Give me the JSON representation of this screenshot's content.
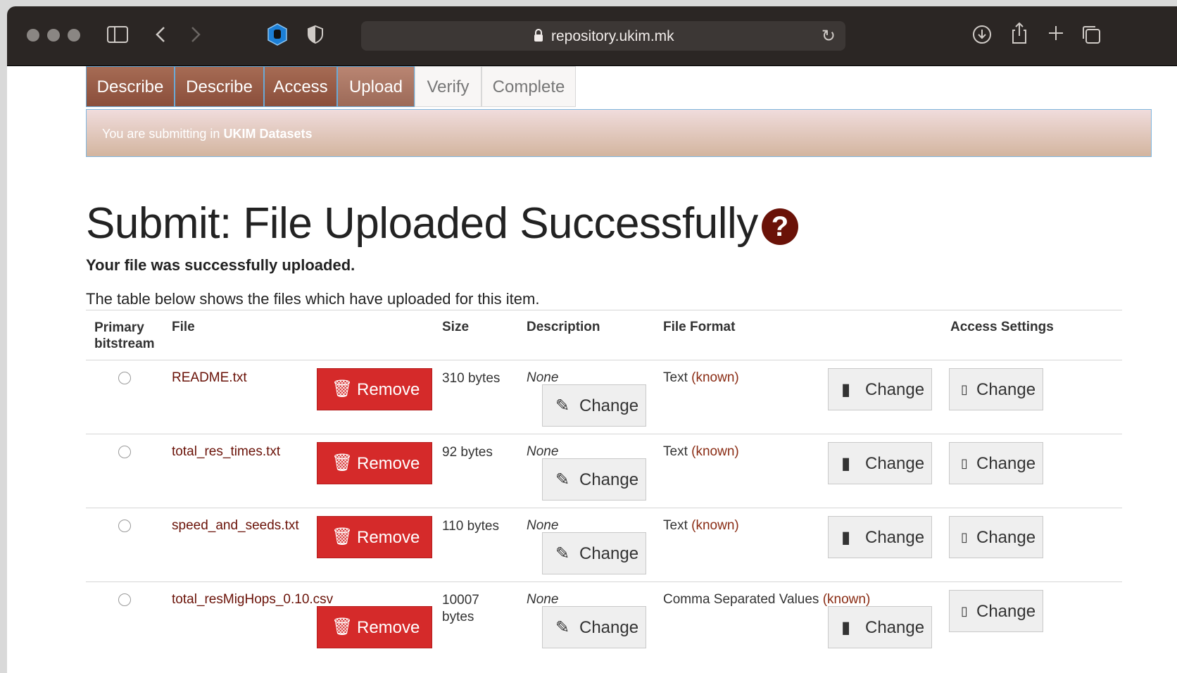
{
  "browser": {
    "url": "repository.ukim.mk",
    "icons": [
      "sidebar-icon",
      "back-icon",
      "forward-icon",
      "privacy-hand-icon",
      "shield-icon",
      "lock-icon",
      "reload-icon",
      "download-icon",
      "share-icon",
      "new-tab-icon",
      "tab-overview-icon"
    ]
  },
  "tabs": [
    "Describe",
    "Describe",
    "Access",
    "Upload",
    "Verify",
    "Complete"
  ],
  "banner": {
    "prefix": "You are submitting in ",
    "collection": "UKIM Datasets"
  },
  "page": {
    "title": "Submit: File Uploaded Successfully",
    "help_glyph": "?",
    "lead": "Your file was successfully uploaded.",
    "note": "The table below shows the files which have uploaded for this item."
  },
  "table": {
    "headers": {
      "primary": "Primary bitstream",
      "file": "File",
      "size": "Size",
      "description": "Description",
      "format": "File Format",
      "access": "Access Settings"
    },
    "remove_label": "Remove",
    "change_label": "Change",
    "rows": [
      {
        "file": "README.txt",
        "size": "310 bytes",
        "description": "None",
        "format": "Text",
        "known": "(known)"
      },
      {
        "file": "total_res_times.txt",
        "size": "92 bytes",
        "description": "None",
        "format": "Text",
        "known": "(known)"
      },
      {
        "file": "speed_and_seeds.txt",
        "size": "110 bytes",
        "description": "None",
        "format": "Text",
        "known": "(known)"
      },
      {
        "file": "total_resMigHops_0.10.csv",
        "size": "10007 bytes",
        "description": "None",
        "format": "Comma Separated Values",
        "known": "(known)"
      }
    ]
  },
  "colors": {
    "brand": "#6a1208",
    "remove": "#d52a2a",
    "tab_done": "#8a4e3b"
  }
}
